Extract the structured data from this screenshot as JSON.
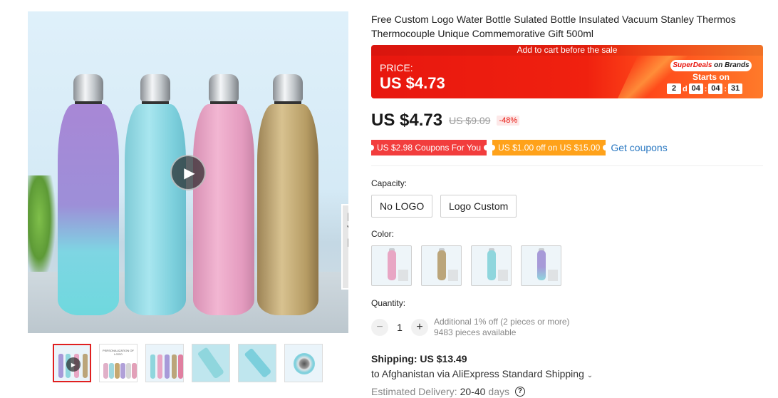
{
  "product": {
    "title": "Free Custom Logo Water Bottle Sulated Bottle Insulated Vacuum Stanley Thermos Thermocouple Unique Commemorative Gift 500ml"
  },
  "sale_banner": {
    "headline": "Add to cart before the sale",
    "price_label": "PRICE:",
    "price_value": "US $4.73",
    "superdeals_label": "SuperDeals",
    "superdeals_suffix": " on Brands",
    "starts_on": "Starts on",
    "countdown": {
      "days": "2",
      "days_unit": "d",
      "hours": "04",
      "minutes": "04",
      "seconds": "31"
    }
  },
  "price": {
    "current": "US $4.73",
    "original": "US $9.09",
    "discount": "-48%"
  },
  "coupons": {
    "coupon1": "US $2.98 Coupons For You",
    "coupon2": "US $1.00 off on US $15.00",
    "get_link": "Get coupons"
  },
  "options": {
    "capacity_label": "Capacity:",
    "capacity_values": [
      "No LOGO",
      "Logo Custom"
    ],
    "color_label": "Color:",
    "color_swatches": [
      "#e8a6c4",
      "#bba57a",
      "#8fd6dd",
      "#a79ad8"
    ]
  },
  "quantity": {
    "label": "Quantity:",
    "value": "1",
    "minus_icon": "−",
    "plus_icon": "+",
    "additional_offer": "Additional 1% off (2 pieces or more)",
    "available": "9483 pieces available"
  },
  "shipping": {
    "title": "Shipping: US $13.49",
    "destination": "to Afghanistan via AliExpress Standard Shipping",
    "chevron": "⌄",
    "delivery_label": "Estimated Delivery:",
    "delivery_days": "20-40",
    "delivery_unit": "days",
    "help_icon": "?"
  },
  "gallery": {
    "play_icon": "▶",
    "book_text": "DESIG YEAR De"
  },
  "colors": {
    "accent_red": "#e8170f",
    "coupon_red": "#f23d3d",
    "coupon_orange": "#ffa21a",
    "link_blue": "#2b79c2"
  }
}
